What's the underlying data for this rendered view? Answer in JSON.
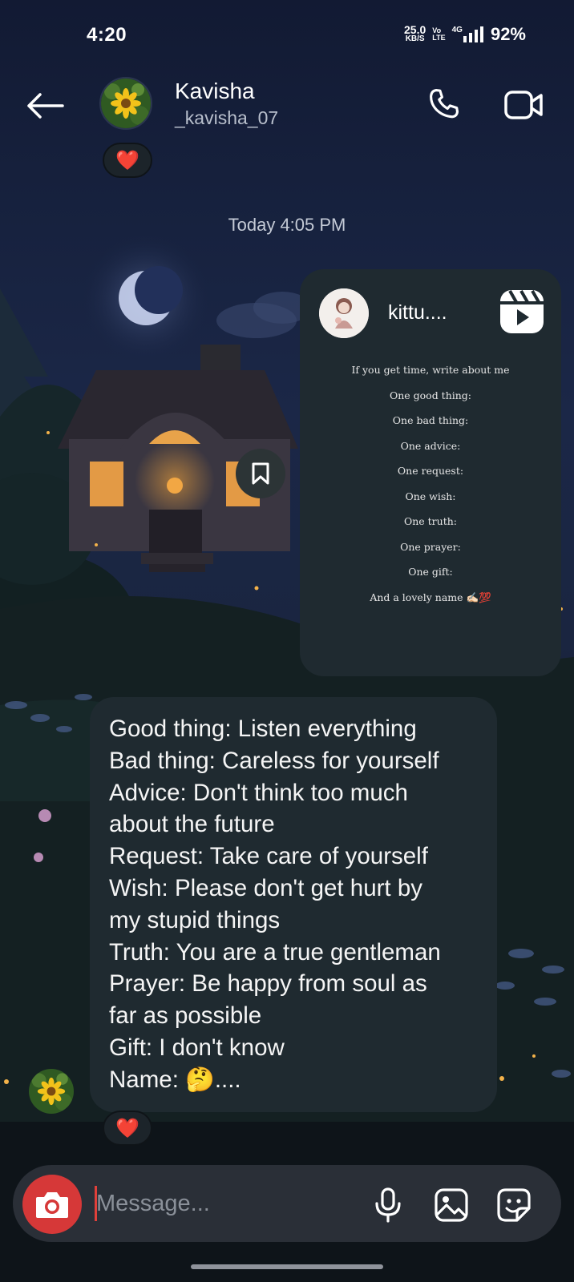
{
  "status_bar": {
    "time": "4:20",
    "speed_value": "25.0",
    "speed_unit": "KB/S",
    "volte_top": "Vo",
    "volte_bottom": "LTE",
    "network": "4G",
    "battery": "92%"
  },
  "header": {
    "contact_name": "Kavisha",
    "contact_handle": "_kavisha_07"
  },
  "reactions": {
    "top": "❤️",
    "bottom": "❤️"
  },
  "timestamp": "Today 4:05 PM",
  "shared_reel": {
    "username": "kittu....",
    "lines": [
      "If you get time, write about me",
      "One good thing:",
      "One bad thing:",
      "One advice:",
      "One request:",
      "One wish:",
      "One truth:",
      "One prayer:",
      "One gift:",
      "And a lovely name ✍🏻💯"
    ]
  },
  "message": {
    "lines": [
      "Good thing: Listen everything",
      "Bad thing: Careless for yourself",
      "Advice: Don't think too much",
      "about the future",
      "Request: Take care of yourself",
      "Wish: Please don't get hurt by",
      "my stupid things",
      "Truth: You are a true gentleman",
      "Prayer: Be happy from soul as",
      "far as possible",
      "Gift: I don't know",
      "Name: 🤔...."
    ]
  },
  "composer": {
    "placeholder": "Message..."
  },
  "colors": {
    "bubble": "#1f2a30",
    "camera_button": "#d63838",
    "composer": "#2a2f37"
  },
  "icons": [
    "back-arrow-icon",
    "phone-icon",
    "video-camera-icon",
    "reel-icon",
    "bookmark-icon",
    "camera-icon",
    "microphone-icon",
    "gallery-icon",
    "sticker-icon"
  ]
}
